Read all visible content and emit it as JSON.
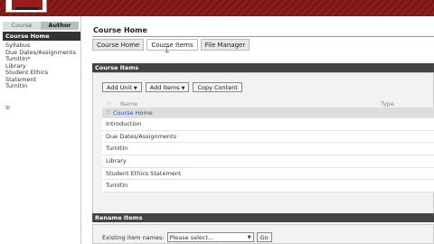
{
  "sidebar": {
    "tabs": [
      {
        "label": "Course"
      },
      {
        "label": "Author"
      }
    ],
    "items": [
      {
        "label": "Course Home"
      },
      {
        "label": "Syllabus"
      },
      {
        "label": "Due Dates/Assignments"
      },
      {
        "label": "TurnItIn*"
      },
      {
        "label": "Library"
      },
      {
        "label": "Student Ethics"
      },
      {
        "label": "Statement"
      },
      {
        "label": "TurnItIn"
      }
    ]
  },
  "main": {
    "title": "Course Home",
    "tabs": [
      {
        "label": "Course Home"
      },
      {
        "label": "Course Items"
      },
      {
        "label": "File Manager"
      }
    ],
    "course_items": {
      "section_label": "Course Items",
      "toolbar": {
        "add_unit": "Add Unit",
        "add_items": "Add Items",
        "copy_content": "Copy Content"
      },
      "columns": {
        "name": "Name",
        "type": "Type"
      },
      "rows": [
        {
          "name": "Course Home"
        },
        {
          "name": "Introduction"
        },
        {
          "name": "Due Dates/Assignments"
        },
        {
          "name": "TurnItIn"
        },
        {
          "name": "Library"
        },
        {
          "name": "Student Ethics Statement"
        },
        {
          "name": "TurnItIn"
        }
      ]
    },
    "rename": {
      "section_label": "Rename Items",
      "field_label": "Existing item names:",
      "select_value": "Please select...",
      "go_label": "Go"
    }
  },
  "colors": {
    "banner": "#8c1d1d",
    "section_bar": "#444444",
    "link": "#2a56a8"
  }
}
